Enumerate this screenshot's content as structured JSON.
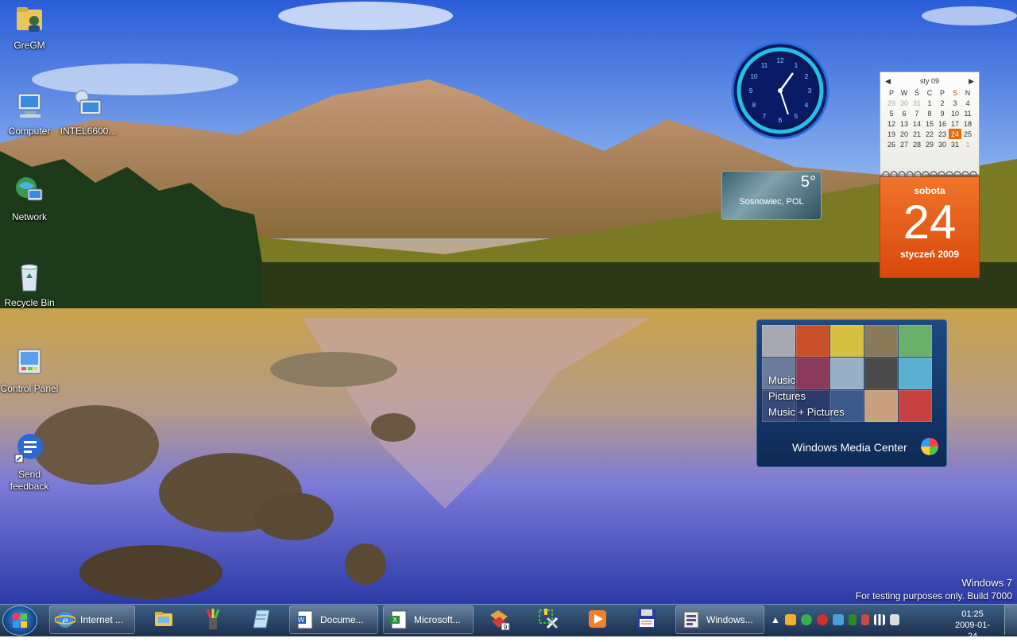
{
  "desktop_icons": [
    {
      "label": "GreGM",
      "icon": "user-folder-icon"
    },
    {
      "label": "Computer",
      "icon": "computer-icon"
    },
    {
      "label": "INTEL6600...",
      "icon": "network-computer-icon"
    },
    {
      "label": "Network",
      "icon": "network-globe-icon"
    },
    {
      "label": "Recycle Bin",
      "icon": "recycle-bin-icon"
    },
    {
      "label": "Control Panel",
      "icon": "control-panel-icon"
    },
    {
      "label": "Send feedback",
      "icon": "feedback-shortcut-icon"
    }
  ],
  "gadgets": {
    "calendar": {
      "month": "sty 09",
      "weekdays": [
        "P",
        "W",
        "Ś",
        "C",
        "P",
        "S",
        "N"
      ],
      "weeks": [
        [
          "29",
          "30",
          "31",
          "1",
          "2",
          "3",
          "4"
        ],
        [
          "5",
          "6",
          "7",
          "8",
          "9",
          "10",
          "11"
        ],
        [
          "12",
          "13",
          "14",
          "15",
          "16",
          "17",
          "18"
        ],
        [
          "19",
          "20",
          "21",
          "22",
          "23",
          "24",
          "25"
        ],
        [
          "26",
          "27",
          "28",
          "29",
          "30",
          "31",
          "1"
        ]
      ],
      "today": "24",
      "day_name": "sobota",
      "day_number": "24",
      "month_year": "styczeń 2009"
    },
    "weather": {
      "temperature": "5°",
      "location": "Sosnowiec, POL"
    },
    "media_center": {
      "items": [
        "Music",
        "Pictures",
        "Music + Pictures"
      ],
      "title": "Windows Media Center"
    }
  },
  "watermark": {
    "line1": "Windows 7",
    "line2": "For testing purposes only. Build 7000"
  },
  "taskbar": {
    "windows": [
      {
        "label": "Internet ...",
        "icon": "internet-explorer-icon"
      },
      {
        "label": "Docume...",
        "icon": "word-document-icon"
      },
      {
        "label": "Microsoft...",
        "icon": "excel-icon"
      },
      {
        "label": "Windows...",
        "icon": "windows-app-icon"
      }
    ],
    "pinned": [
      "explorer-icon",
      "paint-tools-icon",
      "notepad-icon",
      "app-badge-icon",
      "tools-icon",
      "media-player-icon",
      "floppy-disk-icon"
    ],
    "tray_icons": [
      "show-hidden-icons-icon",
      "messenger-icon",
      "skype-icon",
      "gear-tray-icon",
      "network-users-icon",
      "battery-icon",
      "usb-icon",
      "signal-icon",
      "volume-icon"
    ],
    "time": "01:25",
    "date": "2009-01-24"
  },
  "colors": {
    "accent": "#e8680a",
    "taskbar": "#1b2f4c"
  }
}
